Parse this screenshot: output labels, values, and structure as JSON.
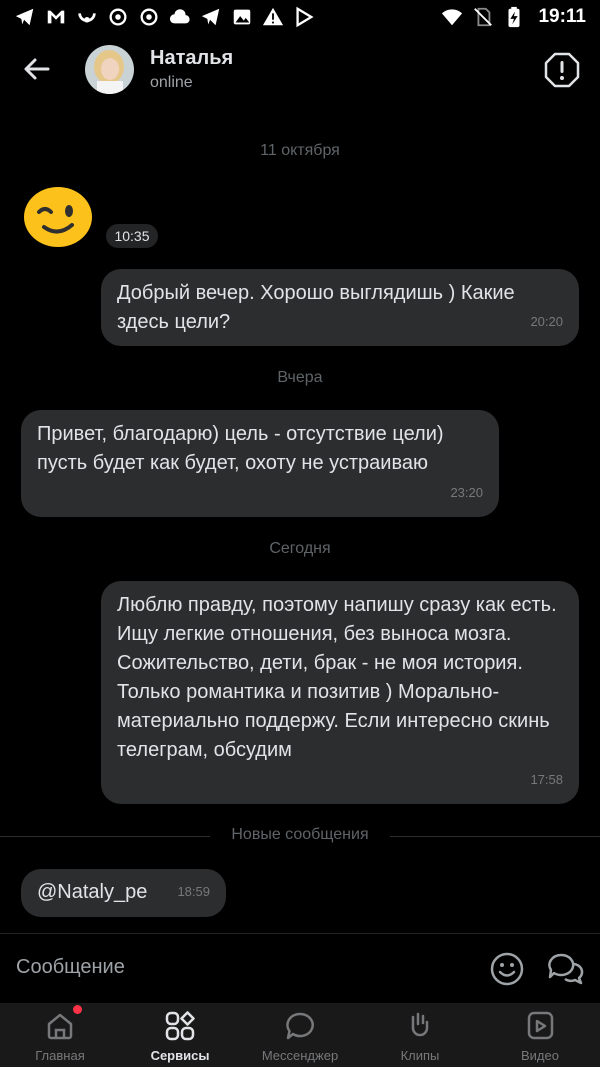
{
  "status_bar": {
    "time": "19:11",
    "left_icons": [
      "telegram-icon",
      "gmail-icon",
      "smile-icon",
      "app-icon",
      "app-icon",
      "cloud-icon",
      "telegram-icon",
      "image-icon",
      "warning-icon",
      "play-icon"
    ],
    "right_icons": [
      "wifi-icon",
      "no-sim-icon",
      "battery-charging-icon"
    ]
  },
  "header": {
    "name": "Наталья",
    "status": "online"
  },
  "messages": {
    "date_1": "11 октября",
    "sticker_time": "10:35",
    "m1_text": "Добрый вечер. Хорошо выглядишь ) Какие здесь цели?",
    "m1_time": "20:20",
    "date_2": "Вчера",
    "m2_text": "Привет, благодарю) цель - отсутствие цели) пусть будет как будет, охоту не устраиваю",
    "m2_time": "23:20",
    "date_3": "Сегодня",
    "m3_text": "Люблю правду, поэтому напишу сразу как есть. Ищу легкие отношения, без выноса мозга. Сожительство, дети, брак - не моя история. Только романтика и позитив ) Морально-материально поддержу. Если интересно скинь телеграм, обсудим",
    "m3_time": "17:58",
    "new_messages_label": "Новые сообщения",
    "m4_text": "@Nataly_pe",
    "m4_time": "18:59"
  },
  "composer": {
    "placeholder": "Сообщение"
  },
  "nav": {
    "home": "Главная",
    "services": "Сервисы",
    "messenger": "Мессенджер",
    "clips": "Клипы",
    "video": "Видео"
  },
  "colors": {
    "background": "#000000",
    "bubble": "#2c2d2e",
    "text": "#e1e3e6",
    "muted": "#76787a",
    "badge": "#ff3347",
    "sticker": "#fcc21b"
  }
}
